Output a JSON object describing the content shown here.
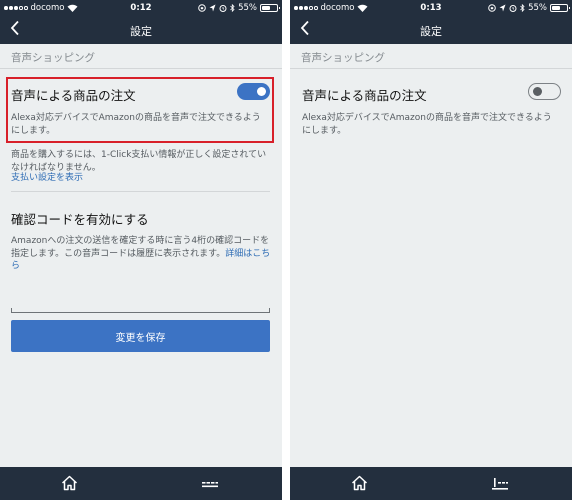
{
  "screens": [
    {
      "status": {
        "carrier": "docomo",
        "time": "0:12",
        "battery": "55%",
        "battery_fraction": 0.55
      },
      "nav": {
        "title": "設定"
      },
      "section_header": "音声ショッピング",
      "voice_order": {
        "title": "音声による商品の注文",
        "enabled": true,
        "description": "Alexa対応デバイスでAmazonの商品を音声で注文できるようにします。"
      },
      "payment_note": "商品を購入するには、1-Click支払い情報が正しく設定されていなければなりません。",
      "payment_link": "支払い設定を表示",
      "confirmation_code": {
        "title": "確認コードを有効にする",
        "description": "Amazonへの注文の送信を確定する時に言う4桁の確認コードを指定します。この音声コードは履歴に表示されます。",
        "details_link": "詳細はこちら",
        "input_value": "",
        "input_placeholder": ""
      },
      "save_label": "変更を保存",
      "tabs": [
        {
          "icon": "home-icon"
        },
        {
          "icon": "menu-icon"
        }
      ]
    },
    {
      "status": {
        "carrier": "docomo",
        "time": "0:13",
        "battery": "55%",
        "battery_fraction": 0.55
      },
      "nav": {
        "title": "設定"
      },
      "section_header": "音声ショッピング",
      "voice_order": {
        "title": "音声による商品の注文",
        "enabled": false,
        "description": "Alexa対応デバイスでAmazonの商品を音声で注文できるようにします。"
      },
      "tabs": [
        {
          "icon": "home-icon"
        },
        {
          "icon": "menu-icon"
        }
      ]
    }
  ],
  "colors": {
    "header_bg": "#232f3e",
    "accent": "#3c73c4",
    "link": "#2f6db5",
    "highlight": "#d8202a",
    "page_bg": "#eceff0"
  }
}
